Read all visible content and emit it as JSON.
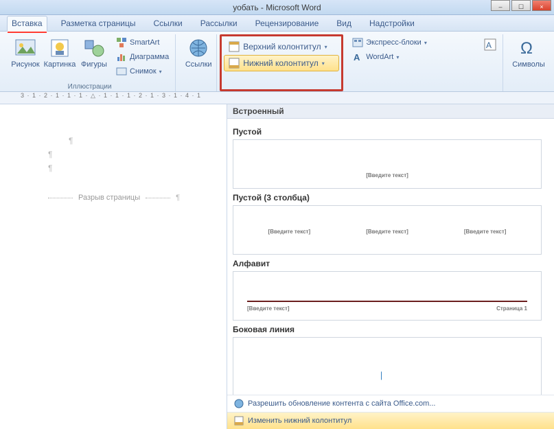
{
  "title_bar": "уобать - Microsoft Word",
  "tabs": {
    "insert": "Вставка",
    "page_layout": "Разметка страницы",
    "references": "Ссылки",
    "mailings": "Рассылки",
    "review": "Рецензирование",
    "view": "Вид",
    "addins": "Надстройки"
  },
  "ribbon": {
    "picture": "Рисунок",
    "clipart": "Картинка",
    "shapes": "Фигуры",
    "smartart": "SmartArt",
    "chart": "Диаграмма",
    "screenshot": "Снимок",
    "illustrations_group": "Иллюстрации",
    "links": "Ссылки",
    "header": "Верхний колонтитул",
    "footer": "Нижний колонтитул",
    "quick_parts": "Экспресс-блоки",
    "wordart": "WordArt",
    "symbols": "Символы"
  },
  "ruler_text": "3 · 1 · 2 · 1 · 1 · 1 · △ · 1 · 1 · 1 · 2 · 1 · 3 · 1 · 4 · 1",
  "document": {
    "page_break": "Разрыв страницы"
  },
  "gallery": {
    "section_header": "Встроенный",
    "empty": "Пустой",
    "empty_3col": "Пустой (3 столбца)",
    "alphabet": "Алфавит",
    "side_line": "Боковая линия",
    "placeholder": "[Введите текст]",
    "page_n": "Страница 1",
    "allow_update": "Разрешить обновление контента с сайта Office.com...",
    "edit_footer": "Изменить нижний колонтитул"
  }
}
